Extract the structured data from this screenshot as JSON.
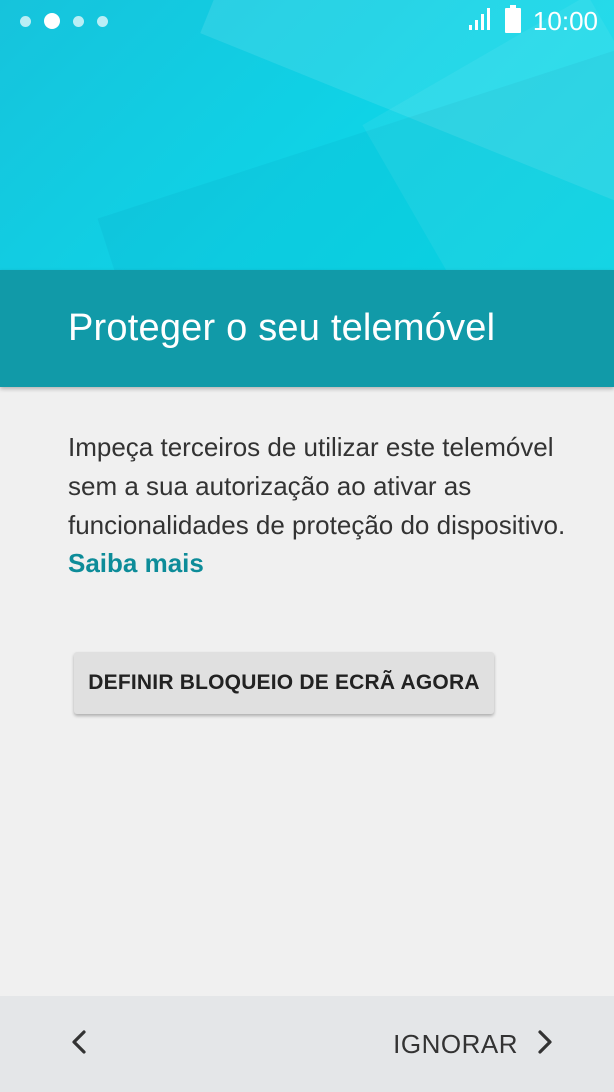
{
  "status_bar": {
    "time": "10:00",
    "page_indicator_count": 4,
    "active_page_index": 1
  },
  "title": "Proteger o seu telemóvel",
  "description": "Impeça terceiros de utilizar este telemóvel sem a sua autorização ao ativar as funcionalidades de proteção do dispositivo.",
  "learn_more_label": "Saiba mais",
  "primary_button_label": "DEFINIR BLOQUEIO DE ECRÃ AGORA",
  "bottom_nav": {
    "skip_label": "IGNORAR"
  },
  "colors": {
    "hero": "#16c3dc",
    "title_band": "#119aa8",
    "link": "#0d8c99",
    "background": "#f0f0f0",
    "bottom_bar": "#e4e6e8"
  },
  "icons": {
    "signal": "signal-icon",
    "battery": "battery-icon",
    "back": "chevron-left-icon",
    "next": "chevron-right-icon"
  }
}
